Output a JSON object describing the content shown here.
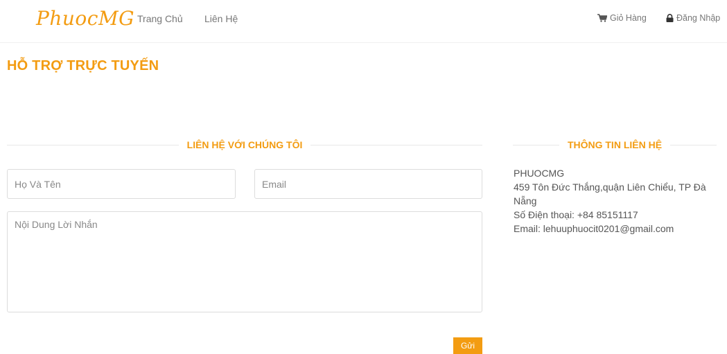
{
  "nav": {
    "brand": "PhuocMG",
    "links": [
      {
        "label": "Trang Chủ"
      },
      {
        "label": "Liên Hệ"
      }
    ],
    "cart_label": "Giỏ Hàng",
    "login_label": "Đăng Nhập"
  },
  "page": {
    "title": "HỖ TRỢ TRỰC TUYẾN"
  },
  "contact_form": {
    "heading": "LIÊN HỆ VỚI CHÚNG TÔI",
    "name_placeholder": "Họ Và Tên",
    "email_placeholder": "Email",
    "message_placeholder": "Nội Dung Lời Nhắn",
    "submit_label": "Gửi"
  },
  "contact_info": {
    "heading": "THÔNG TIN LIÊN HỆ",
    "company": "PHUOCMG",
    "address": "459 Tôn Đức Thắng,quận Liên Chiểu, TP Đà Nẵng",
    "phone": "Số Điện thoại: +84 85151117",
    "email": "Email: lehuuphuocit0201@gmail.com"
  },
  "colors": {
    "accent": "#f39c12",
    "text": "#555555",
    "nav_text": "#777777",
    "border": "#dcdcdc"
  },
  "icons": {
    "cart": "cart-icon",
    "login": "lock-icon"
  }
}
